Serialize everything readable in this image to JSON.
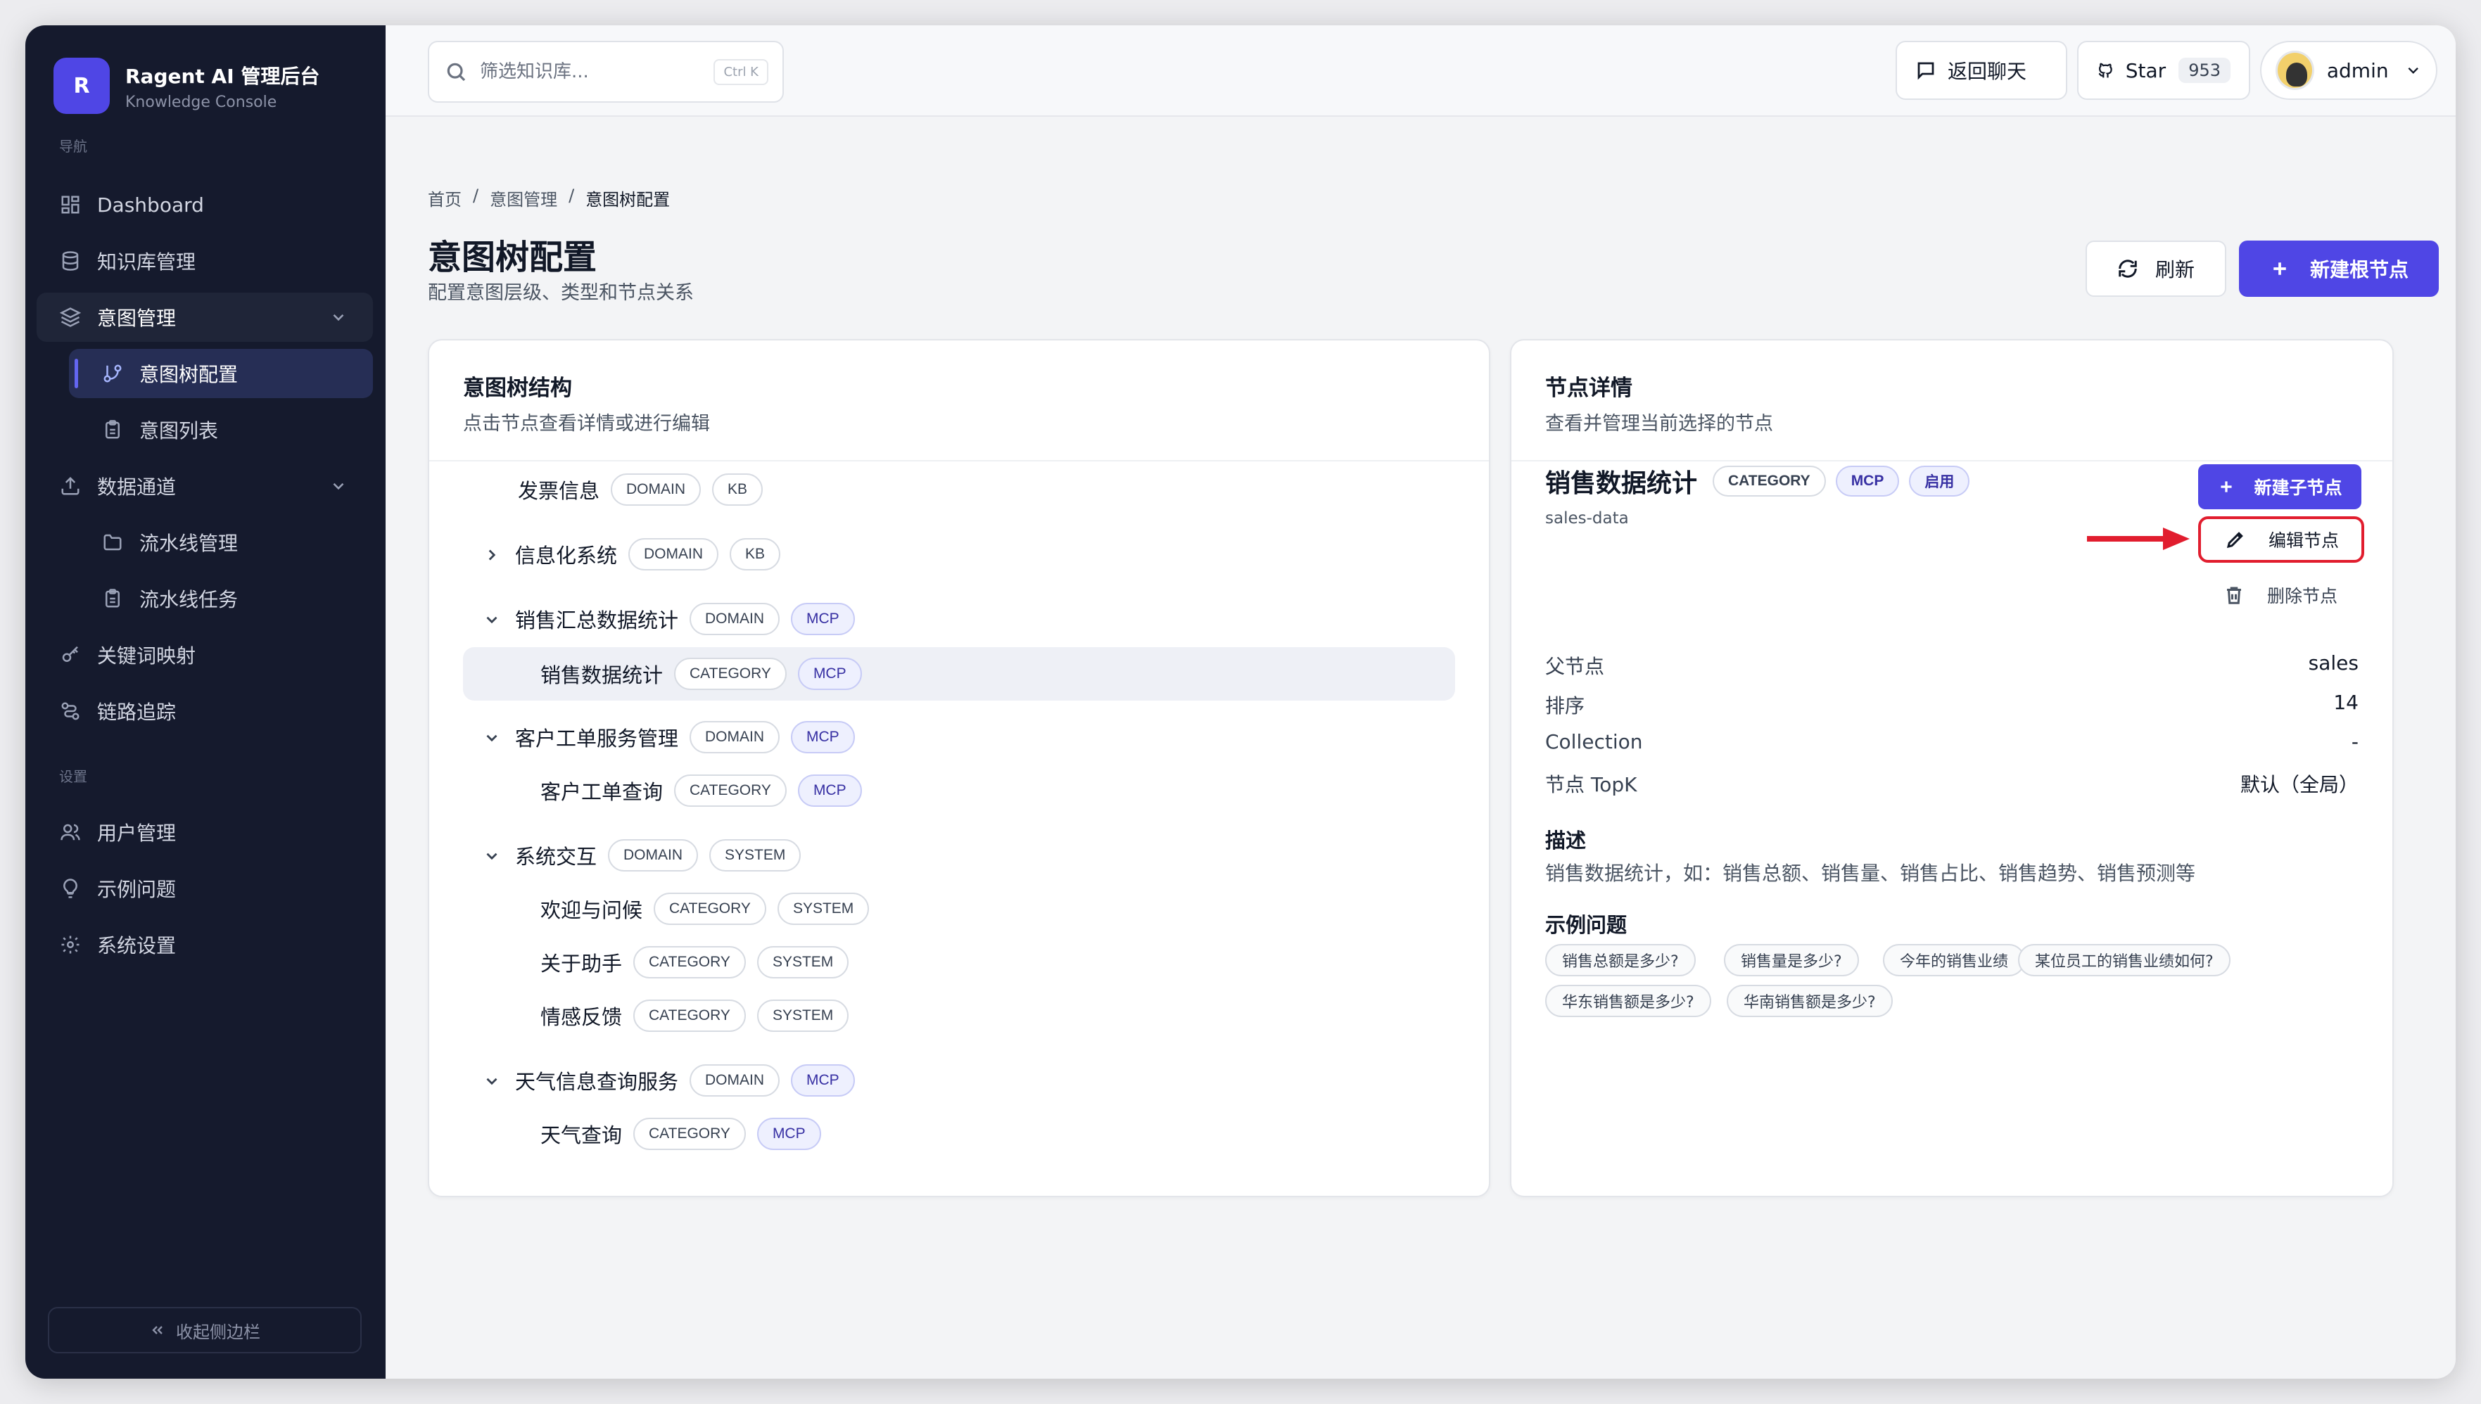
{
  "brand": {
    "logo_letter": "R",
    "title": "Ragent AI 管理后台",
    "subtitle": "Knowledge Console"
  },
  "sidebar": {
    "section_nav": "导航",
    "section_settings": "设置",
    "items": [
      {
        "label": "Dashboard",
        "icon": "dashboard-icon"
      },
      {
        "label": "知识库管理",
        "icon": "database-icon"
      },
      {
        "label": "意图管理",
        "icon": "layers-icon",
        "expanded": true
      },
      {
        "label": "意图树配置",
        "icon": "git-branch-icon",
        "active": true
      },
      {
        "label": "意图列表",
        "icon": "clipboard-icon"
      },
      {
        "label": "数据通道",
        "icon": "upload-icon",
        "expanded": true
      },
      {
        "label": "流水线管理",
        "icon": "folder-icon"
      },
      {
        "label": "流水线任务",
        "icon": "clipboard-icon"
      },
      {
        "label": "关键词映射",
        "icon": "key-icon"
      },
      {
        "label": "链路追踪",
        "icon": "route-icon"
      },
      {
        "label": "用户管理",
        "icon": "users-icon"
      },
      {
        "label": "示例问题",
        "icon": "lightbulb-icon"
      },
      {
        "label": "系统设置",
        "icon": "gear-icon"
      }
    ],
    "collapse_label": "收起侧边栏"
  },
  "topbar": {
    "search_placeholder": "筛选知识库...",
    "search_shortcut": "Ctrl K",
    "back_chat_label": "返回聊天",
    "star_label": "Star",
    "star_count": "953",
    "user_name": "admin"
  },
  "breadcrumb": [
    "首页",
    "意图管理",
    "意图树配置"
  ],
  "page": {
    "title": "意图树配置",
    "description": "配置意图层级、类型和节点关系",
    "refresh_label": "刷新",
    "new_root_label": "新建根节点"
  },
  "tree_card": {
    "title": "意图树结构",
    "description": "点击节点查看详情或进行编辑",
    "nodes": [
      {
        "name": "发票信息",
        "tags": [
          "DOMAIN",
          "KB"
        ]
      },
      {
        "name": "信息化系统",
        "tags": [
          "DOMAIN",
          "KB"
        ],
        "caret": "right"
      },
      {
        "name": "销售汇总数据统计",
        "tags": [
          "DOMAIN",
          "MCP"
        ],
        "caret": "down"
      },
      {
        "name": "销售数据统计",
        "tags": [
          "CATEGORY",
          "MCP"
        ],
        "selected": true
      },
      {
        "name": "客户工单服务管理",
        "tags": [
          "DOMAIN",
          "MCP"
        ],
        "caret": "down"
      },
      {
        "name": "客户工单查询",
        "tags": [
          "CATEGORY",
          "MCP"
        ]
      },
      {
        "name": "系统交互",
        "tags": [
          "DOMAIN",
          "SYSTEM"
        ],
        "caret": "down"
      },
      {
        "name": "欢迎与问候",
        "tags": [
          "CATEGORY",
          "SYSTEM"
        ]
      },
      {
        "name": "关于助手",
        "tags": [
          "CATEGORY",
          "SYSTEM"
        ]
      },
      {
        "name": "情感反馈",
        "tags": [
          "CATEGORY",
          "SYSTEM"
        ]
      },
      {
        "name": "天气信息查询服务",
        "tags": [
          "DOMAIN",
          "MCP"
        ],
        "caret": "down"
      },
      {
        "name": "天气查询",
        "tags": [
          "CATEGORY",
          "MCP"
        ]
      }
    ]
  },
  "detail_card": {
    "title": "节点详情",
    "description": "查看并管理当前选择的节点",
    "node_name": "销售数据统计",
    "node_tags": [
      "CATEGORY",
      "MCP",
      "启用"
    ],
    "node_code": "sales-data",
    "new_child_label": "新建子节点",
    "edit_label": "编辑节点",
    "delete_label": "删除节点",
    "fields": [
      {
        "key": "父节点",
        "value": "sales"
      },
      {
        "key": "排序",
        "value": "14"
      },
      {
        "key": "Collection",
        "value": "-"
      },
      {
        "key": "节点 TopK",
        "value": "默认（全局）"
      }
    ],
    "desc_heading": "描述",
    "desc_text": "销售数据统计，如：销售总额、销售量、销售占比、销售趋势、销售预测等",
    "examples_heading": "示例问题",
    "examples": [
      "销售总额是多少?",
      "销售量是多少?",
      "今年的销售业绩",
      "某位员工的销售业绩如何?",
      "华东销售额是多少?",
      "华南销售额是多少?"
    ]
  },
  "colors": {
    "accent": "#4f46e5",
    "sidebar_bg": "#151a2d",
    "highlight_red": "#e11d2e"
  }
}
